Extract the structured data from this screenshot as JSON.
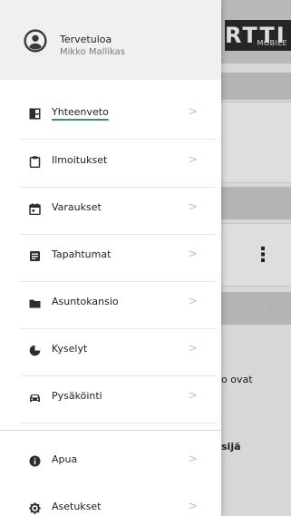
{
  "background": {
    "logo_text": "RTTI",
    "logo_sub": "MOBILE",
    "text_fragment_1": "o ovat",
    "text_fragment_2": "sijä"
  },
  "drawer": {
    "greeting": "Tervetuloa",
    "user_name": "Mikko Mallikas",
    "items": [
      {
        "label": "Yhteenveto",
        "icon": "dashboard-icon",
        "active": true
      },
      {
        "label": "Ilmoitukset",
        "icon": "clipboard-icon"
      },
      {
        "label": "Varaukset",
        "icon": "calendar-icon"
      },
      {
        "label": "Tapahtumat",
        "icon": "list-icon"
      },
      {
        "label": "Asuntokansio",
        "icon": "folder-icon"
      },
      {
        "label": "Kyselyt",
        "icon": "pie-chart-icon"
      },
      {
        "label": "Pysäköinti",
        "icon": "car-icon"
      }
    ],
    "secondary_items": [
      {
        "label": "Apua",
        "icon": "info-icon"
      },
      {
        "label": "Asetukset",
        "icon": "settings-icon"
      }
    ]
  },
  "colors": {
    "active_underline": "#3f8f72",
    "header_bg": "#f0f0f0"
  }
}
